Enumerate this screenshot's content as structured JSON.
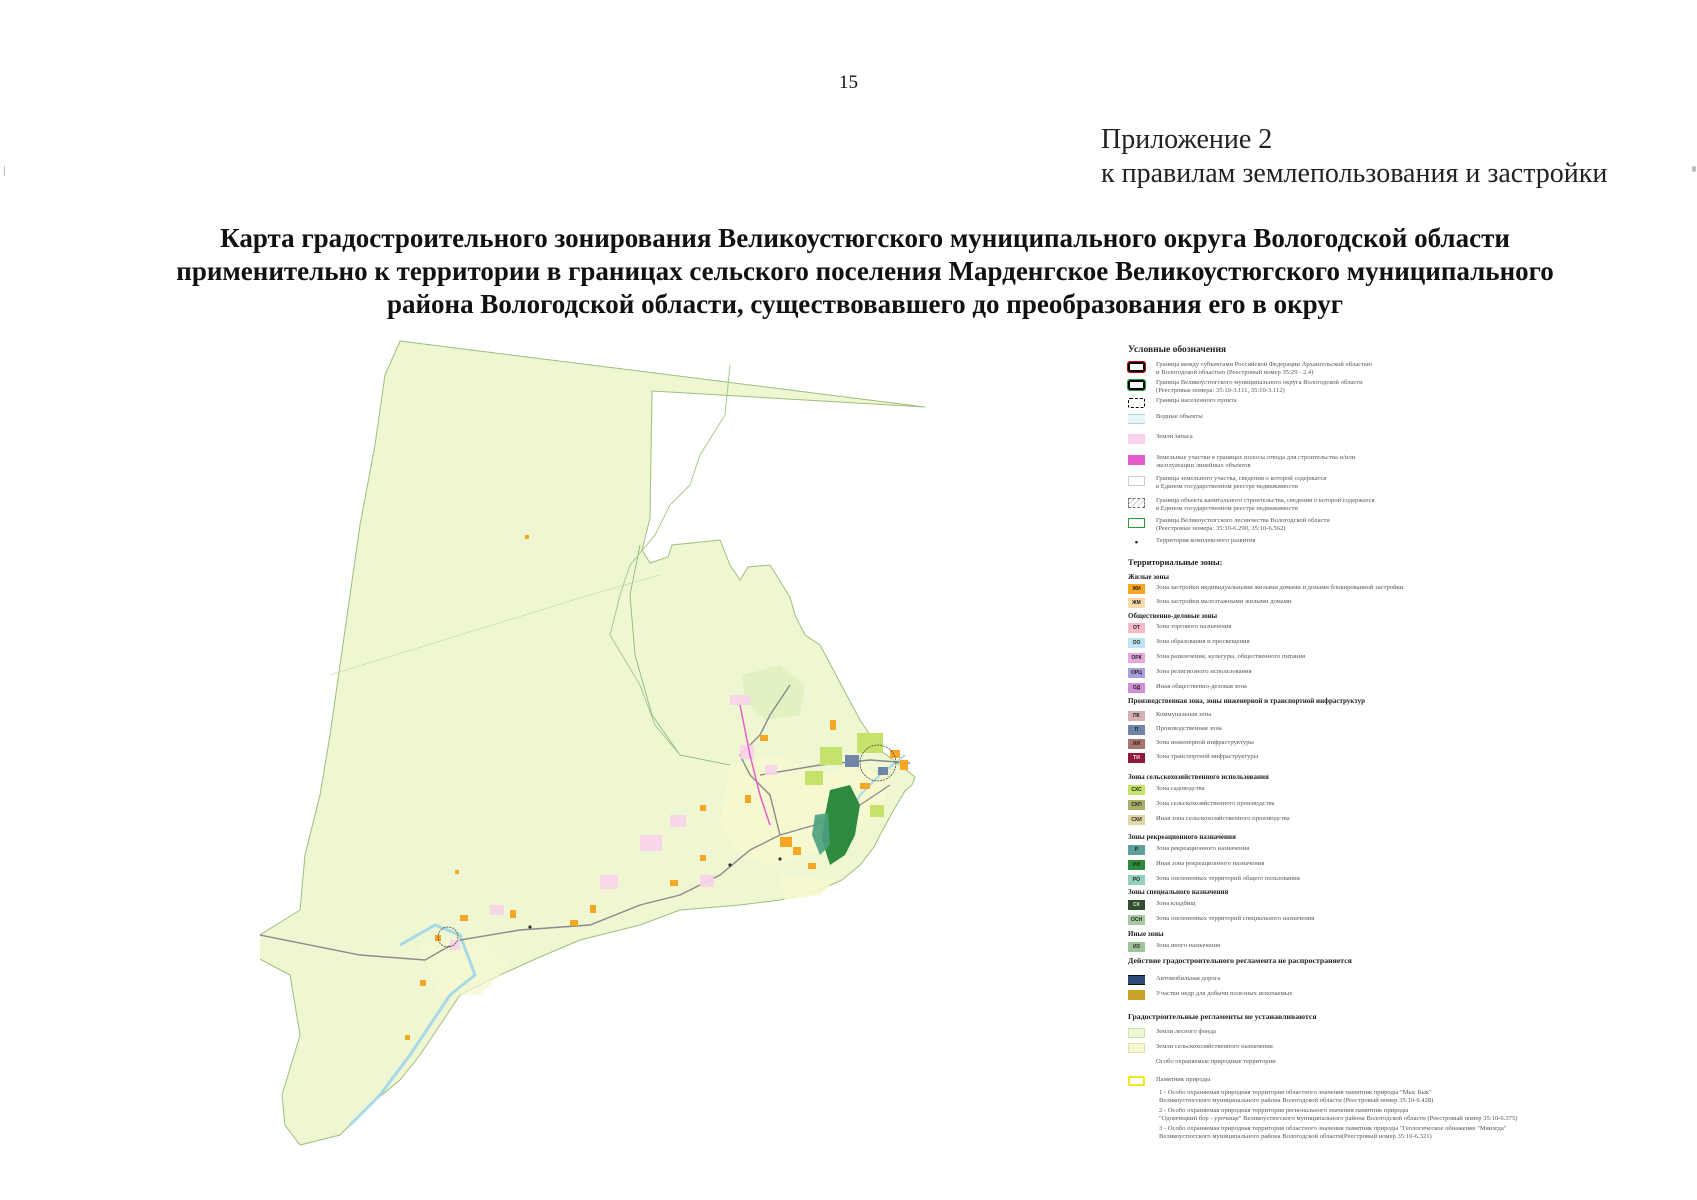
{
  "page_number": "15",
  "appendix": {
    "line1": "Приложение 2",
    "line2": "к правилам землепользования и застройки"
  },
  "title": {
    "line1": "Карта градостроительного зонирования Великоустюгского муниципального округа Вологодской области",
    "line2": "применительно к территории в границах сельского поселения Марденгское Великоустюгского муниципального",
    "line3": "района Вологодской области, существовавшего до преобразования его в округ"
  },
  "colors": {
    "forest_land": "#eef7d2",
    "agricultural_land": "#f6f8cf",
    "water": "#a8d8e8",
    "road": "#8a8a8a",
    "settlement_orange": "#f5a623",
    "recreation_green": "#2e8b3e",
    "gardening": "#c5e26a"
  },
  "legend": {
    "heading": "Условные обозначения",
    "boundaries": [
      {
        "code": "",
        "line1": "Граница между субъектами Российской Федерации Архангельской областью",
        "line2": "и Вологодской областью (Реестровый номер 35:29 - 2.4)"
      },
      {
        "code": "",
        "line1": "Граница Великоустюгского муниципального округа Вологодской области",
        "line2": "(Реестровые номера: 35:10-3.111, 35:10-3.112)"
      },
      {
        "code": "",
        "line1": "Граница населенного пункта",
        "line2": ""
      },
      {
        "code": "",
        "line1": "Водные объекты",
        "line2": ""
      },
      {
        "code": "",
        "line1": "Земли запаса",
        "line2": ""
      },
      {
        "code": "",
        "line1": "Земельные участки в границах полосы отвода для строительства и/или",
        "line2": "эксплуатации линейных объектов"
      },
      {
        "code": "",
        "line1": "Граница земельного участка, сведения о которой содержатся",
        "line2": "в Едином государственном реестре недвижимости"
      },
      {
        "code": "",
        "line1": "Граница объекта капитального строительства, сведения о которой содержатся",
        "line2": "в Едином государственном реестре недвижимости"
      },
      {
        "code": "",
        "line1": "Граница Великоустюгского лесничества Вологодской области",
        "line2": "(Реестровые номера: 35:10-6.290, 35:10-6.562)"
      },
      {
        "code": "",
        "line1": "Территория комплексного развития",
        "line2": ""
      }
    ],
    "zones_heading": "Территориальные зоны:",
    "groups": [
      {
        "name": "Жилые зоны",
        "items": [
          {
            "code": "ЖИ",
            "label": "Зона застройки индивидуальными жилыми домами и домами блокированной застройки"
          },
          {
            "code": "ЖМ",
            "label": "Зона застройки малоэтажными жилыми домами"
          }
        ]
      },
      {
        "name": "Общественно-деловые зоны",
        "items": [
          {
            "code": "ОТ",
            "label": "Зона торгового назначения"
          },
          {
            "code": "ОО",
            "label": "Зона образования и просвещения"
          },
          {
            "code": "ОРК",
            "label": "Зона развлечения, культуры, общественного питания"
          },
          {
            "code": "ОРЦ",
            "label": "Зона религиозного использования"
          },
          {
            "code": "ОД",
            "label": "Иная общественно-деловая зона"
          }
        ]
      },
      {
        "name": "Производственная зона, зоны инженерной и транспортной инфраструктур",
        "items": [
          {
            "code": "ПК",
            "label": "Коммунальная зона"
          },
          {
            "code": "П",
            "label": "Производственная зона"
          },
          {
            "code": "ИИ",
            "label": "Зона инженерной инфраструктуры"
          },
          {
            "code": "ТИ",
            "label": "Зона транспортной инфраструктуры"
          }
        ]
      },
      {
        "name": "Зоны сельскохозяйственного использования",
        "items": [
          {
            "code": "СХС",
            "label": "Зона садоводства"
          },
          {
            "code": "СХП",
            "label": "Зона сельскохозяйственного производства"
          },
          {
            "code": "СХИ",
            "label": "Иная зона сельскохозяйственного производства"
          }
        ]
      },
      {
        "name": "Зоны рекреационного назначения",
        "items": [
          {
            "code": "Р",
            "label": "Зона рекреационного назначения"
          },
          {
            "code": "РИ",
            "label": "Иная зона рекреационного назначения"
          },
          {
            "code": "РО",
            "label": "Зона озелененных территорий общего пользования"
          }
        ]
      },
      {
        "name": "Зоны специального назначения",
        "items": [
          {
            "code": "СК",
            "label": "Зона кладбищ"
          },
          {
            "code": "ОСН",
            "label": "Зона озелененных территорий специального назначения"
          }
        ]
      },
      {
        "name": "Иные зоны",
        "items": [
          {
            "code": "ИЗ",
            "label": "Зона иного назначения"
          }
        ]
      }
    ],
    "no_regulation_heading": "Действие градостроительного регламента не распространяется",
    "no_regulation_items": [
      {
        "label": "Автомобильная дорога"
      },
      {
        "label": "Участки недр для добычи полезных ископаемых"
      }
    ],
    "not_established_heading": "Градостроительные регламенты не устанавливаются",
    "not_established_items": [
      {
        "label": "Земли лесного фонда"
      },
      {
        "label": "Земли сельскохозяйственного назначения"
      },
      {
        "label": "Особо охраняемые природные территории"
      }
    ],
    "monuments_label": "Памятник природы",
    "monuments": [
      {
        "line1": "1 - Особо охраняемая природная территория областного значения памятник природы \"Мыс Бык\"",
        "line2": "Великоустюгского муниципального района Вологодской области (Реестровый номер 35:10-6.428)"
      },
      {
        "line1": "2 - Особо охраняемая природная территория регионального значения памятник природы",
        "line2": "\"Одомчецкий бор - урочище\" Великоустюгского муниципального района Вологодской области (Реестровый номер 35:10-6.375)"
      },
      {
        "line1": "3 - Особо охраняемая природная территория областного значения памятник природы \"Геологическое обнажение \"Мянэгда\"",
        "line2": "Великоустюгского муниципального района Вологодской области(Реестровый номер 35:10-6.321)"
      }
    ]
  }
}
